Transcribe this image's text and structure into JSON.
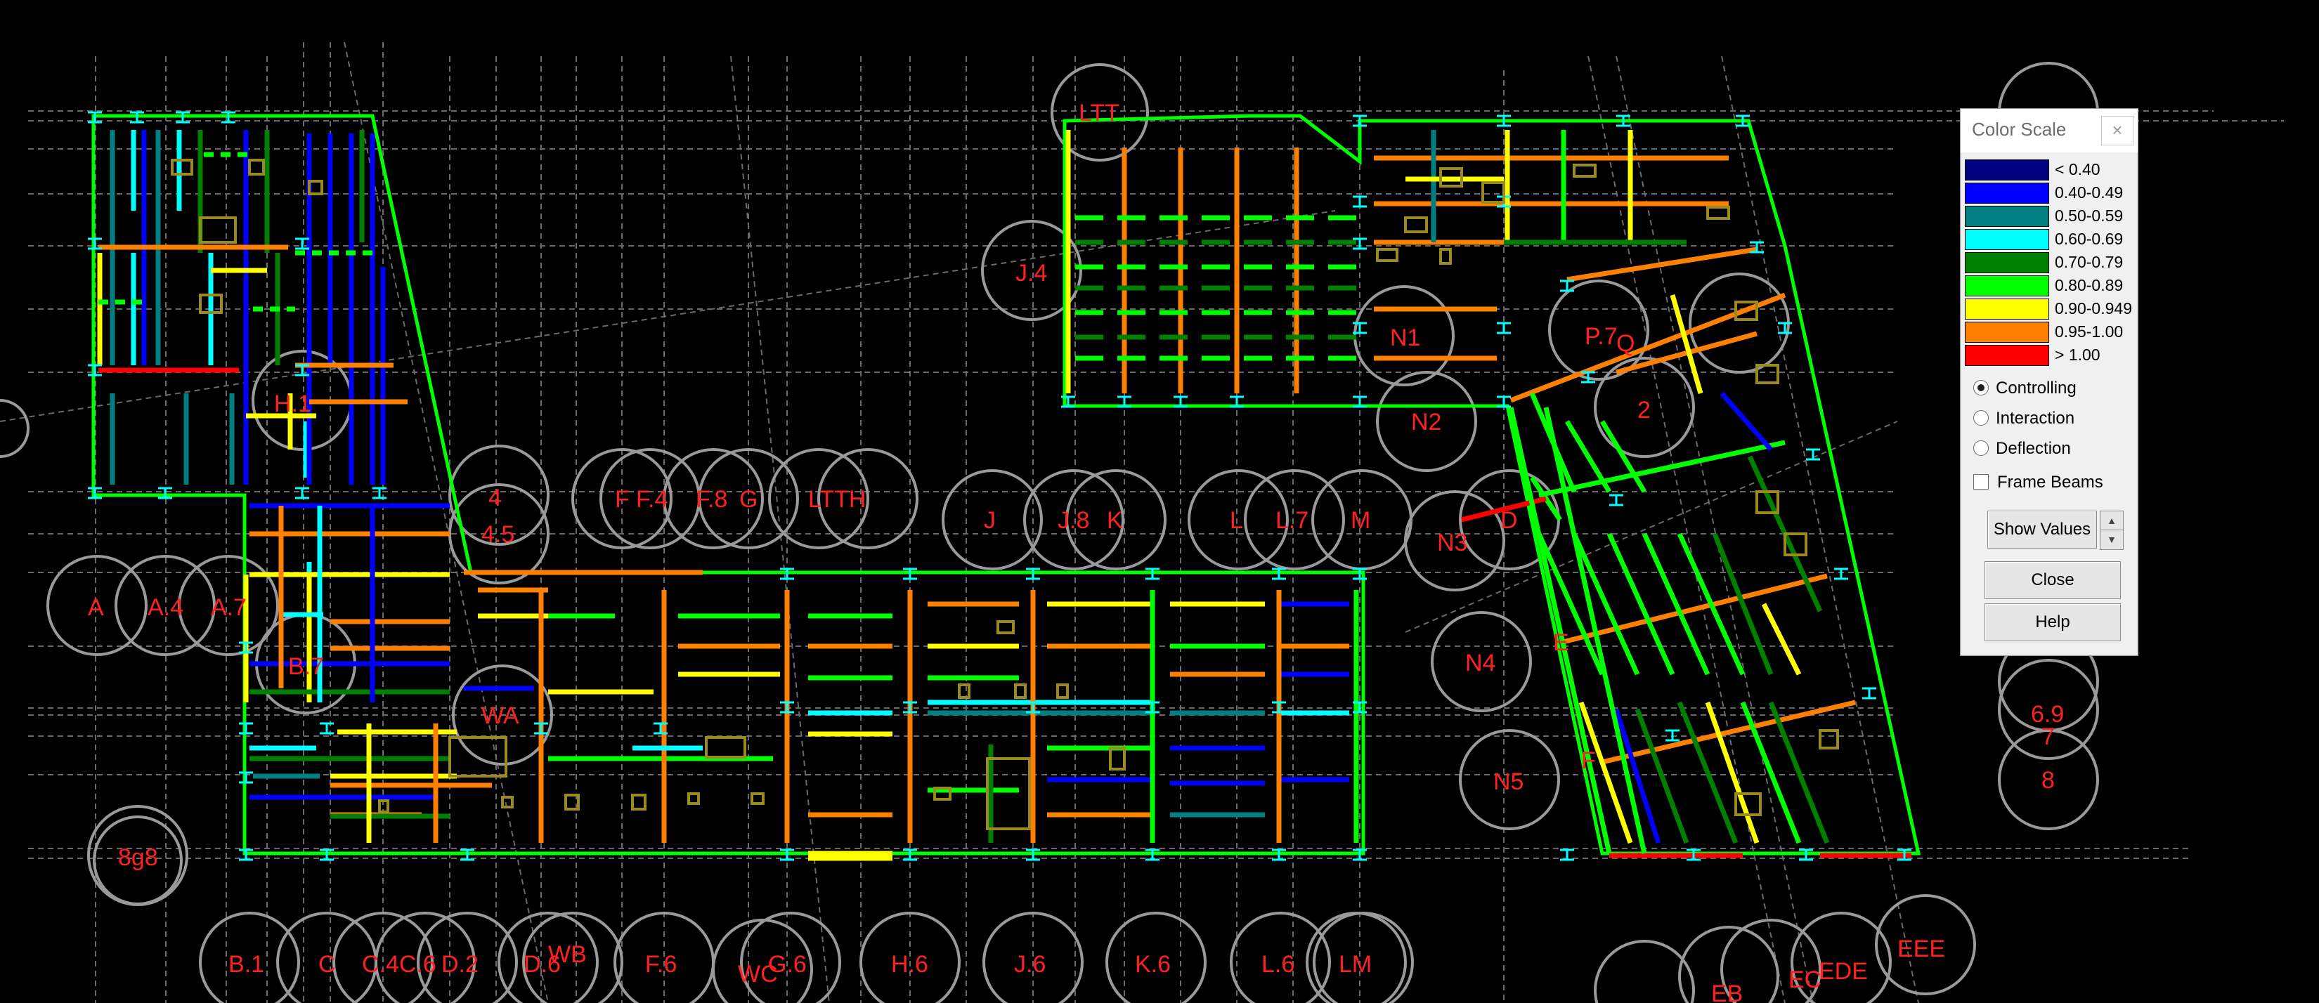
{
  "grid_labels_top": [
    {
      "id": "A",
      "text": "A"
    },
    {
      "id": "A4",
      "text": "A.4"
    },
    {
      "id": "A7",
      "text": "A.7"
    },
    {
      "id": "B7",
      "text": "B.7"
    },
    {
      "id": "H1",
      "text": "H.1"
    },
    {
      "id": "4",
      "text": "4"
    },
    {
      "id": "45",
      "text": "4.5"
    },
    {
      "id": "F",
      "text": "F"
    },
    {
      "id": "F4",
      "text": "F.4"
    },
    {
      "id": "F8",
      "text": "F.8"
    },
    {
      "id": "G",
      "text": "G"
    },
    {
      "id": "LTTH",
      "text": "LTTH"
    },
    {
      "id": "J",
      "text": "J"
    },
    {
      "id": "J8",
      "text": "J.8"
    },
    {
      "id": "K",
      "text": "K"
    },
    {
      "id": "L",
      "text": "L"
    },
    {
      "id": "L7",
      "text": "L.7"
    },
    {
      "id": "M",
      "text": "M"
    },
    {
      "id": "J4",
      "text": "J.4"
    },
    {
      "id": "LTT",
      "text": "LTT"
    },
    {
      "id": "N1",
      "text": "N1"
    },
    {
      "id": "N2",
      "text": "N2"
    },
    {
      "id": "N3",
      "text": "N3"
    },
    {
      "id": "N4",
      "text": "N4"
    },
    {
      "id": "N5",
      "text": "N5"
    },
    {
      "id": "P7",
      "text": "P.7"
    },
    {
      "id": "Q",
      "text": "Q"
    },
    {
      "id": "2",
      "text": "2"
    },
    {
      "id": "WA",
      "text": "WA"
    },
    {
      "id": "8g8",
      "text": "8g8"
    },
    {
      "id": "69",
      "text": "6.9"
    },
    {
      "id": "7",
      "text": "7"
    },
    {
      "id": "8",
      "text": "8"
    },
    {
      "id": "D",
      "text": "D"
    },
    {
      "id": "E",
      "text": "E"
    },
    {
      "id": "Fr",
      "text": "F"
    }
  ],
  "grid_labels_bottom": [
    {
      "id": "B1",
      "text": "B.1"
    },
    {
      "id": "C",
      "text": "C"
    },
    {
      "id": "C4",
      "text": "C.4C.6"
    },
    {
      "id": "D2",
      "text": "D.2"
    },
    {
      "id": "D6",
      "text": "D.6"
    },
    {
      "id": "WB",
      "text": "WB"
    },
    {
      "id": "F6",
      "text": "F.6"
    },
    {
      "id": "WC",
      "text": "WC"
    },
    {
      "id": "G6",
      "text": "G.6"
    },
    {
      "id": "H6",
      "text": "H.6"
    },
    {
      "id": "J6",
      "text": "J.6"
    },
    {
      "id": "K6",
      "text": "K.6"
    },
    {
      "id": "L6",
      "text": "L.6"
    },
    {
      "id": "LM",
      "text": "LM"
    },
    {
      "id": "EB",
      "text": "EB"
    },
    {
      "id": "EC",
      "text": "EC"
    },
    {
      "id": "EDE",
      "text": "EDE"
    },
    {
      "id": "EEE",
      "text": "EEE"
    }
  ],
  "color_scale": {
    "title": "Color Scale",
    "close_glyph": "×",
    "entries": [
      {
        "label": "< 0.40",
        "color": "#000080"
      },
      {
        "label": "0.40-0.49",
        "color": "#0000ff"
      },
      {
        "label": "0.50-0.59",
        "color": "#008080"
      },
      {
        "label": "0.60-0.69",
        "color": "#00ffff"
      },
      {
        "label": "0.70-0.79",
        "color": "#008000"
      },
      {
        "label": "0.80-0.89",
        "color": "#00ff00"
      },
      {
        "label": "0.90-0.949",
        "color": "#ffff00"
      },
      {
        "label": "0.95-1.00",
        "color": "#ff8000"
      },
      {
        "label": "> 1.00",
        "color": "#ff0000"
      }
    ],
    "options": {
      "controlling": {
        "label": "Controlling",
        "selected": true
      },
      "interaction": {
        "label": "Interaction",
        "selected": false
      },
      "deflection": {
        "label": "Deflection",
        "selected": false
      },
      "frame_beams": {
        "label": "Frame Beams",
        "checked": false
      }
    },
    "buttons": {
      "show_values": "Show Values",
      "close": "Close",
      "help": "Help"
    }
  }
}
